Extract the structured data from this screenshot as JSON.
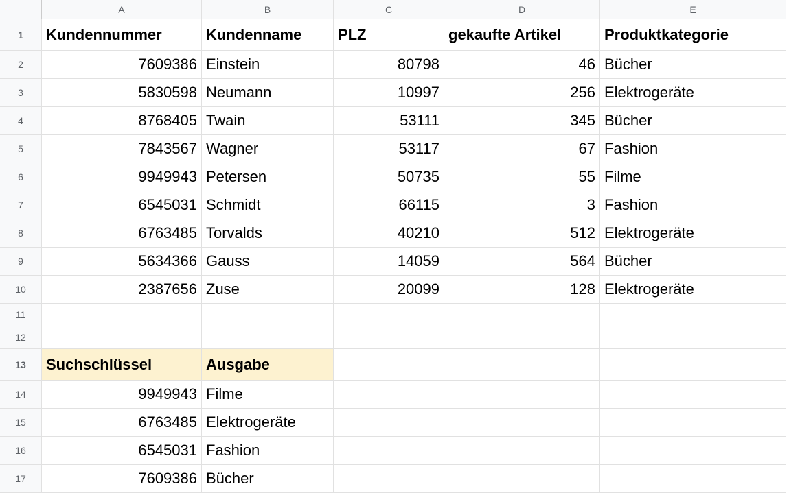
{
  "columns": [
    "A",
    "B",
    "C",
    "D",
    "E"
  ],
  "rows": [
    "1",
    "2",
    "3",
    "4",
    "5",
    "6",
    "7",
    "8",
    "9",
    "10",
    "11",
    "12",
    "13",
    "14",
    "15",
    "16",
    "17"
  ],
  "table1": {
    "headers": {
      "A": "Kundennummer",
      "B": "Kundenname",
      "C": "PLZ",
      "D": "gekaufte Artikel",
      "E": "Produktkategorie"
    },
    "rows": [
      {
        "A": "7609386",
        "B": "Einstein",
        "C": "80798",
        "D": "46",
        "E": "Bücher"
      },
      {
        "A": "5830598",
        "B": "Neumann",
        "C": "10997",
        "D": "256",
        "E": "Elektrogeräte"
      },
      {
        "A": "8768405",
        "B": "Twain",
        "C": "53111",
        "D": "345",
        "E": "Bücher"
      },
      {
        "A": "7843567",
        "B": "Wagner",
        "C": "53117",
        "D": "67",
        "E": "Fashion"
      },
      {
        "A": "9949943",
        "B": "Petersen",
        "C": "50735",
        "D": "55",
        "E": "Filme"
      },
      {
        "A": "6545031",
        "B": "Schmidt",
        "C": "66115",
        "D": "3",
        "E": "Fashion"
      },
      {
        "A": "6763485",
        "B": "Torvalds",
        "C": "40210",
        "D": "512",
        "E": "Elektrogeräte"
      },
      {
        "A": "5634366",
        "B": "Gauss",
        "C": "14059",
        "D": "564",
        "E": "Bücher"
      },
      {
        "A": "2387656",
        "B": "Zuse",
        "C": "20099",
        "D": "128",
        "E": "Elektrogeräte"
      }
    ]
  },
  "table2": {
    "headers": {
      "A": "Suchschlüssel",
      "B": "Ausgabe"
    },
    "rows": [
      {
        "A": "9949943",
        "B": "Filme"
      },
      {
        "A": "6763485",
        "B": "Elektrogeräte"
      },
      {
        "A": "6545031",
        "B": "Fashion"
      },
      {
        "A": "7609386",
        "B": "Bücher"
      }
    ]
  }
}
